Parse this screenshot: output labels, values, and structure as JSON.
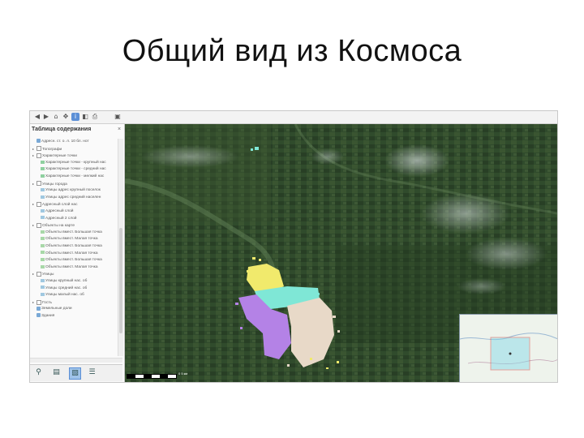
{
  "slide": {
    "title": "Общий вид из Космоса"
  },
  "toolbar": {
    "buttons": [
      {
        "icon": "back-arrow-icon"
      },
      {
        "icon": "forward-arrow-icon"
      },
      {
        "icon": "home-icon"
      },
      {
        "icon": "pan-icon"
      },
      {
        "icon": "identify-icon",
        "active": true
      },
      {
        "icon": "layers-icon"
      },
      {
        "icon": "print-icon"
      },
      {
        "icon": "save-icon"
      }
    ]
  },
  "toc": {
    "title": "Таблица содержания",
    "close_label": "×",
    "items": [
      {
        "label": "Адресн. ст. о. л. 10 бл. нот",
        "indent": 1,
        "type": "layer"
      },
      {
        "label": "Топографи",
        "indent": 0,
        "type": "group"
      },
      {
        "label": "Характерные точки",
        "indent": 0,
        "type": "group-checked"
      },
      {
        "label": "Характерные точки - крупный нас",
        "indent": 2,
        "type": "swatch",
        "color": "#8fd0a0"
      },
      {
        "label": "Характерные точки - средний нас",
        "indent": 2,
        "type": "swatch",
        "color": "#8fd0a0"
      },
      {
        "label": "Характерные точки - мелкий нас",
        "indent": 2,
        "type": "swatch",
        "color": "#8fd0a0"
      },
      {
        "label": "Улицы города",
        "indent": 0,
        "type": "group-checked"
      },
      {
        "label": "Улицы адрес крупный поселок",
        "indent": 2,
        "type": "swatch",
        "color": "#a0c8e0"
      },
      {
        "label": "Улицы адрес средний населен",
        "indent": 2,
        "type": "swatch",
        "color": "#a0c8e0"
      },
      {
        "label": "Адресный слой нас",
        "indent": 0,
        "type": "group-checked"
      },
      {
        "label": "Адресный слой",
        "indent": 2,
        "type": "swatch",
        "color": "#a0c8e0"
      },
      {
        "label": "Адресный 2 слой",
        "indent": 2,
        "type": "swatch",
        "color": "#a0c8e0"
      },
      {
        "label": "Объекты на карте",
        "indent": 0,
        "type": "group-checked"
      },
      {
        "label": "Объекты вмест. Большая точка",
        "indent": 2,
        "type": "swatch",
        "color": "#a8d8a8"
      },
      {
        "label": "Объекты вмест. Малая точка",
        "indent": 2,
        "type": "swatch",
        "color": "#a8d8a8"
      },
      {
        "label": "Объекты вмест. Большая точка",
        "indent": 2,
        "type": "swatch",
        "color": "#a8d8a8"
      },
      {
        "label": "Объекты вмест. Малая точка",
        "indent": 2,
        "type": "swatch",
        "color": "#a8d8a8"
      },
      {
        "label": "Объекты вмест. Большая точка",
        "indent": 2,
        "type": "swatch",
        "color": "#a8d8a8"
      },
      {
        "label": "Объекты вмест. Малая точка",
        "indent": 2,
        "type": "swatch",
        "color": "#a8d8a8"
      },
      {
        "label": "Улицы",
        "indent": 0,
        "type": "group-checked"
      },
      {
        "label": "Улицы крупный нас. об",
        "indent": 2,
        "type": "swatch",
        "color": "#a0c8e0"
      },
      {
        "label": "Улицы средний нас. об",
        "indent": 2,
        "type": "swatch",
        "color": "#a0c8e0"
      },
      {
        "label": "Улицы малый нас. об",
        "indent": 2,
        "type": "swatch",
        "color": "#a0c8e0"
      },
      {
        "label": "Гость",
        "indent": 0,
        "type": "group"
      },
      {
        "label": "Земельные доли",
        "indent": 1,
        "type": "layer"
      },
      {
        "label": "Здания",
        "indent": 1,
        "type": "layer"
      }
    ]
  },
  "panel_tabs": [
    {
      "icon": "binoculars-icon",
      "glyph": "⚲"
    },
    {
      "icon": "book-icon",
      "glyph": "▤"
    },
    {
      "icon": "layer-list-icon",
      "glyph": "▧",
      "active": true
    },
    {
      "icon": "list-icon",
      "glyph": "☰"
    }
  ],
  "map": {
    "scale_label": "0     5 км",
    "colors": {
      "yellow": "#f1ea6c",
      "cyan": "#7fe7d6",
      "purple": "#b482e6",
      "beige": "#e8d9c8",
      "terrain": "#2f4a2a"
    }
  }
}
